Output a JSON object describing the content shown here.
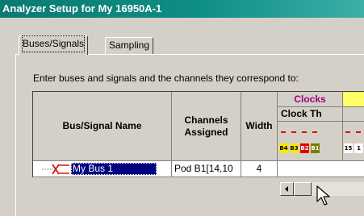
{
  "window": {
    "title": "Analyzer Setup for My 16950A-1"
  },
  "tabs": [
    {
      "label": "Buses/Signals",
      "active": true
    },
    {
      "label": "Sampling",
      "active": false
    }
  ],
  "instruction": "Enter buses and signals and the channels they correspond to:",
  "table": {
    "headers": {
      "name": "Bus/Signal Name",
      "channels": "Channels Assigned",
      "width": "Width",
      "clocks": "Clocks",
      "clock_th": "Clock Th"
    },
    "clock_channels": [
      {
        "label": "B4",
        "color": "#f5ea00"
      },
      {
        "label": "B3",
        "color": "#f5ea00"
      },
      {
        "label": "B2",
        "color": "#e00000"
      },
      {
        "label": "B1",
        "color": "#7a7a00"
      },
      {
        "label": "15",
        "color": "#ffffff"
      },
      {
        "label": "1",
        "color": "#ffffff"
      }
    ],
    "rows": [
      {
        "name": "My Bus 1",
        "channels": "Pod B1[14,10",
        "width": "4"
      }
    ]
  },
  "colors": {
    "clocks_text": "#a0007a",
    "clocks_yellow": "#ffff66",
    "selection": "#000080"
  },
  "icons": {
    "bus": "bus-icon",
    "cursor": "mouse-pointer-icon"
  }
}
